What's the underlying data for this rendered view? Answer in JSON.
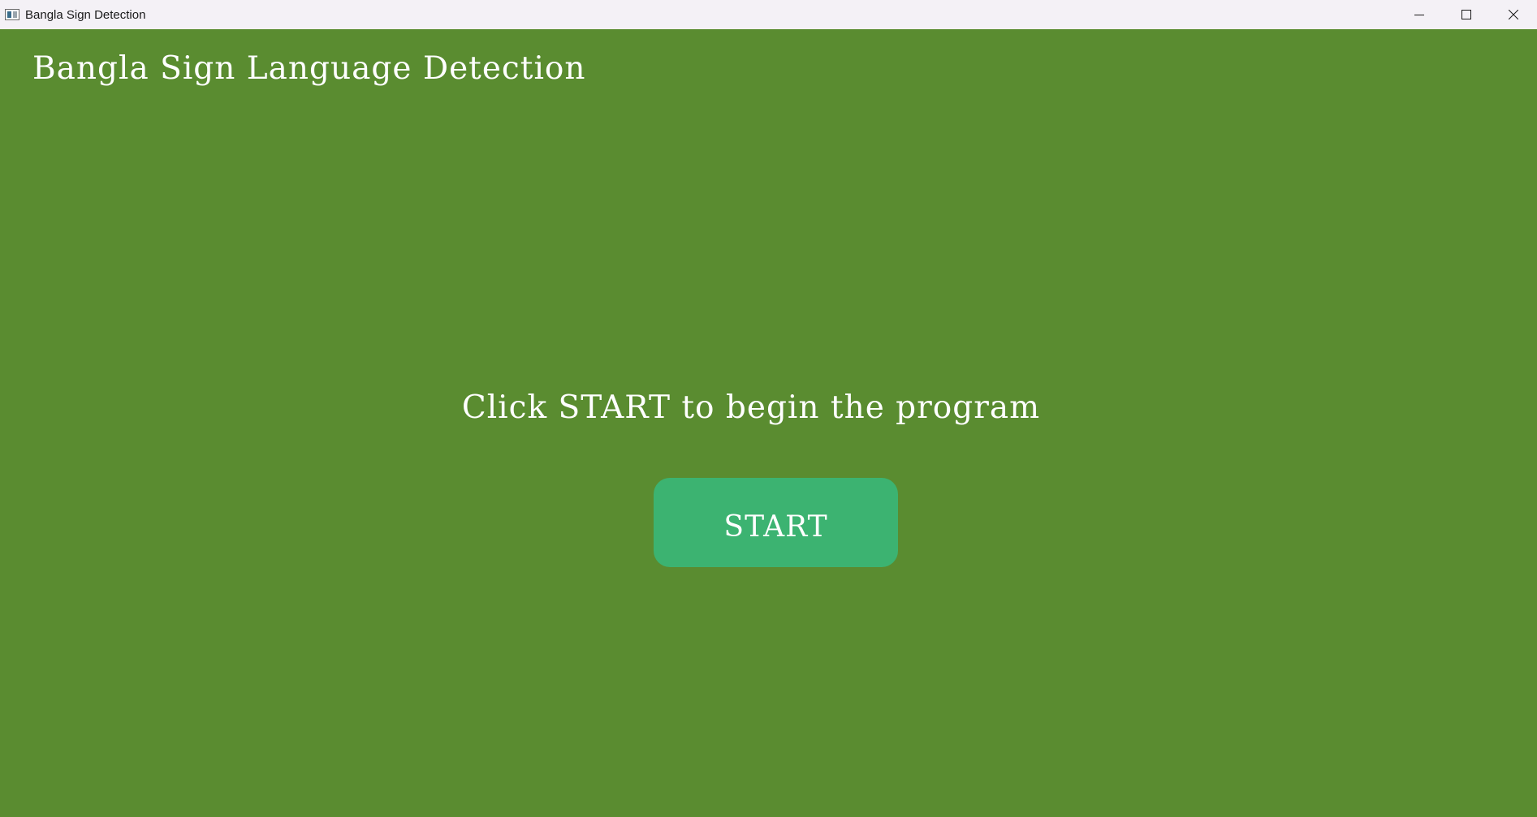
{
  "window": {
    "title": "Bangla Sign Detection",
    "icon": "app-window-icon",
    "controls": {
      "minimize_icon": "minimize-icon",
      "maximize_icon": "maximize-icon",
      "close_icon": "close-icon"
    }
  },
  "main": {
    "heading": "Bangla Sign Language Detection",
    "instruction": "Click START to begin the program",
    "start_button_label": "START"
  },
  "colors": {
    "background": "#5a8c30",
    "button": "#3cb371",
    "text": "#ffffff",
    "titlebar": "#f4f1f6"
  }
}
